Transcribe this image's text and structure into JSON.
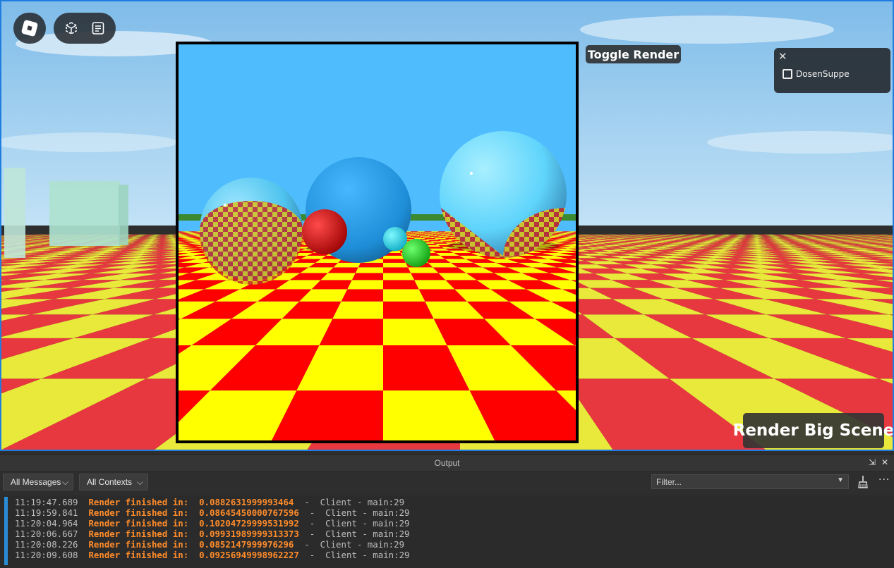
{
  "game": {
    "toggle_render_label": "Toggle Render",
    "render_big_scene_label": "Render Big Scene",
    "player_list": {
      "close_icon": "close-icon",
      "players": [
        {
          "name": "DosenSuppe"
        }
      ]
    },
    "top_bar_icons": [
      "roblox-menu-icon",
      "selection-box-icon",
      "chat-icon"
    ]
  },
  "output": {
    "title": "Output",
    "message_filter": "All Messages",
    "context_filter": "All Contexts",
    "filter_placeholder": "Filter...",
    "logs": [
      {
        "time": "11:19:47.689",
        "message": "Render finished in:  0.0882631999993464",
        "source": "Client - main:29"
      },
      {
        "time": "11:19:59.841",
        "message": "Render finished in:  0.08645450000767596",
        "source": "Client - main:29"
      },
      {
        "time": "11:20:04.964",
        "message": "Render finished in:  0.10204729999531992",
        "source": "Client - main:29"
      },
      {
        "time": "11:20:06.667",
        "message": "Render finished in:  0.09931989999313373",
        "source": "Client - main:29"
      },
      {
        "time": "11:20:08.226",
        "message": "Render finished in:  0.0852147999976296",
        "source": "Client - main:29"
      },
      {
        "time": "11:20:09.608",
        "message": "Render finished in:  0.09256949998962227",
        "source": "Client - main:29"
      }
    ]
  },
  "colors": {
    "accent_blue": "#2a8bd6",
    "log_orange": "#ff8c2a",
    "checker_red": "#ff0000",
    "checker_yellow": "#ffff00",
    "sky": "#4fbdfd"
  }
}
